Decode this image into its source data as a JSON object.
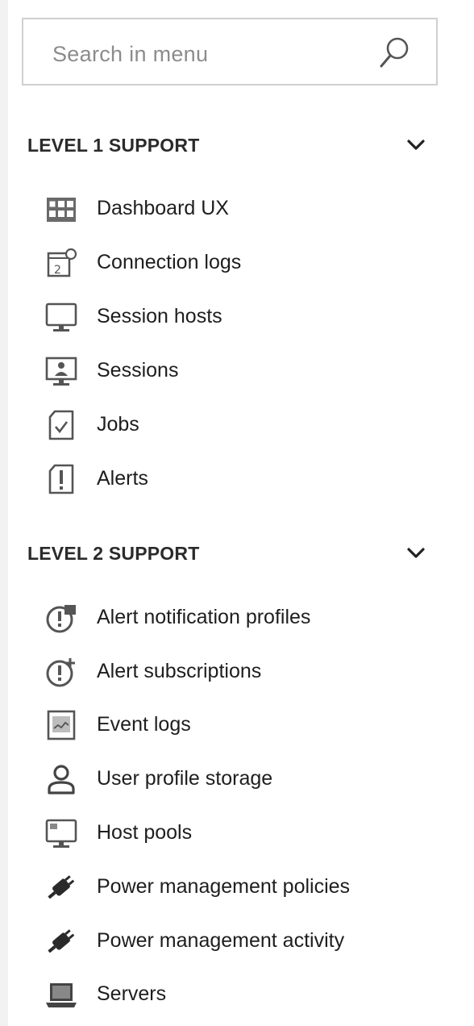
{
  "search": {
    "placeholder": "Search in menu",
    "icon": "search-icon"
  },
  "sections": [
    {
      "title": "LEVEL 1 SUPPORT",
      "items": [
        {
          "label": "Dashboard UX",
          "icon": "dashboard-grid-icon"
        },
        {
          "label": "Connection logs",
          "icon": "connection-log-icon"
        },
        {
          "label": "Session hosts",
          "icon": "monitor-icon"
        },
        {
          "label": "Sessions",
          "icon": "session-user-icon"
        },
        {
          "label": "Jobs",
          "icon": "job-check-icon"
        },
        {
          "label": "Alerts",
          "icon": "alert-document-icon"
        }
      ]
    },
    {
      "title": "LEVEL 2 SUPPORT",
      "items": [
        {
          "label": "Alert notification profiles",
          "icon": "alert-notification-icon"
        },
        {
          "label": "Alert subscriptions",
          "icon": "alert-subscription-icon"
        },
        {
          "label": "Event logs",
          "icon": "event-log-icon"
        },
        {
          "label": "User profile storage",
          "icon": "user-profile-icon"
        },
        {
          "label": "Host pools",
          "icon": "host-pool-icon"
        },
        {
          "label": "Power management policies",
          "icon": "power-plug-icon"
        },
        {
          "label": "Power management activity",
          "icon": "power-plug-icon"
        },
        {
          "label": "Servers",
          "icon": "laptop-server-icon"
        }
      ]
    }
  ]
}
